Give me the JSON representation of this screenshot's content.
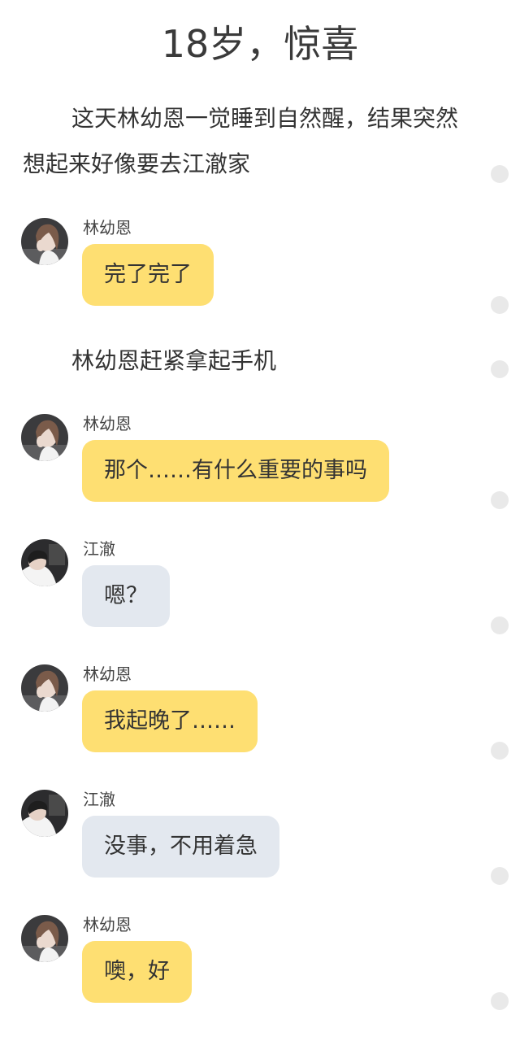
{
  "title": "18岁，惊喜",
  "narration": [
    "这天林幼恩一觉睡到自然醒，结果突然想起来好像要去江澈家",
    "林幼恩赶紧拿起手机"
  ],
  "messages": [
    {
      "sender": "林幼恩",
      "text": "完了完了",
      "avatar": "female-avatar",
      "bubble_color": "#fedf72"
    },
    {
      "sender": "林幼恩",
      "text": "那个……有什么重要的事吗",
      "avatar": "female-avatar",
      "bubble_color": "#fedf72"
    },
    {
      "sender": "江澈",
      "text": "嗯？",
      "avatar": "male-avatar",
      "bubble_color": "#e3e8ef"
    },
    {
      "sender": "林幼恩",
      "text": "我起晚了……",
      "avatar": "female-avatar",
      "bubble_color": "#fedf72"
    },
    {
      "sender": "江澈",
      "text": "没事，不用着急",
      "avatar": "male-avatar",
      "bubble_color": "#e3e8ef"
    },
    {
      "sender": "林幼恩",
      "text": "噢，好",
      "avatar": "female-avatar",
      "bubble_color": "#fedf72"
    }
  ],
  "colors": {
    "background": "#ffffff",
    "bubble_yellow": "#fedf72",
    "bubble_gray": "#e3e8ef",
    "side_dot": "#e9e9e9"
  }
}
